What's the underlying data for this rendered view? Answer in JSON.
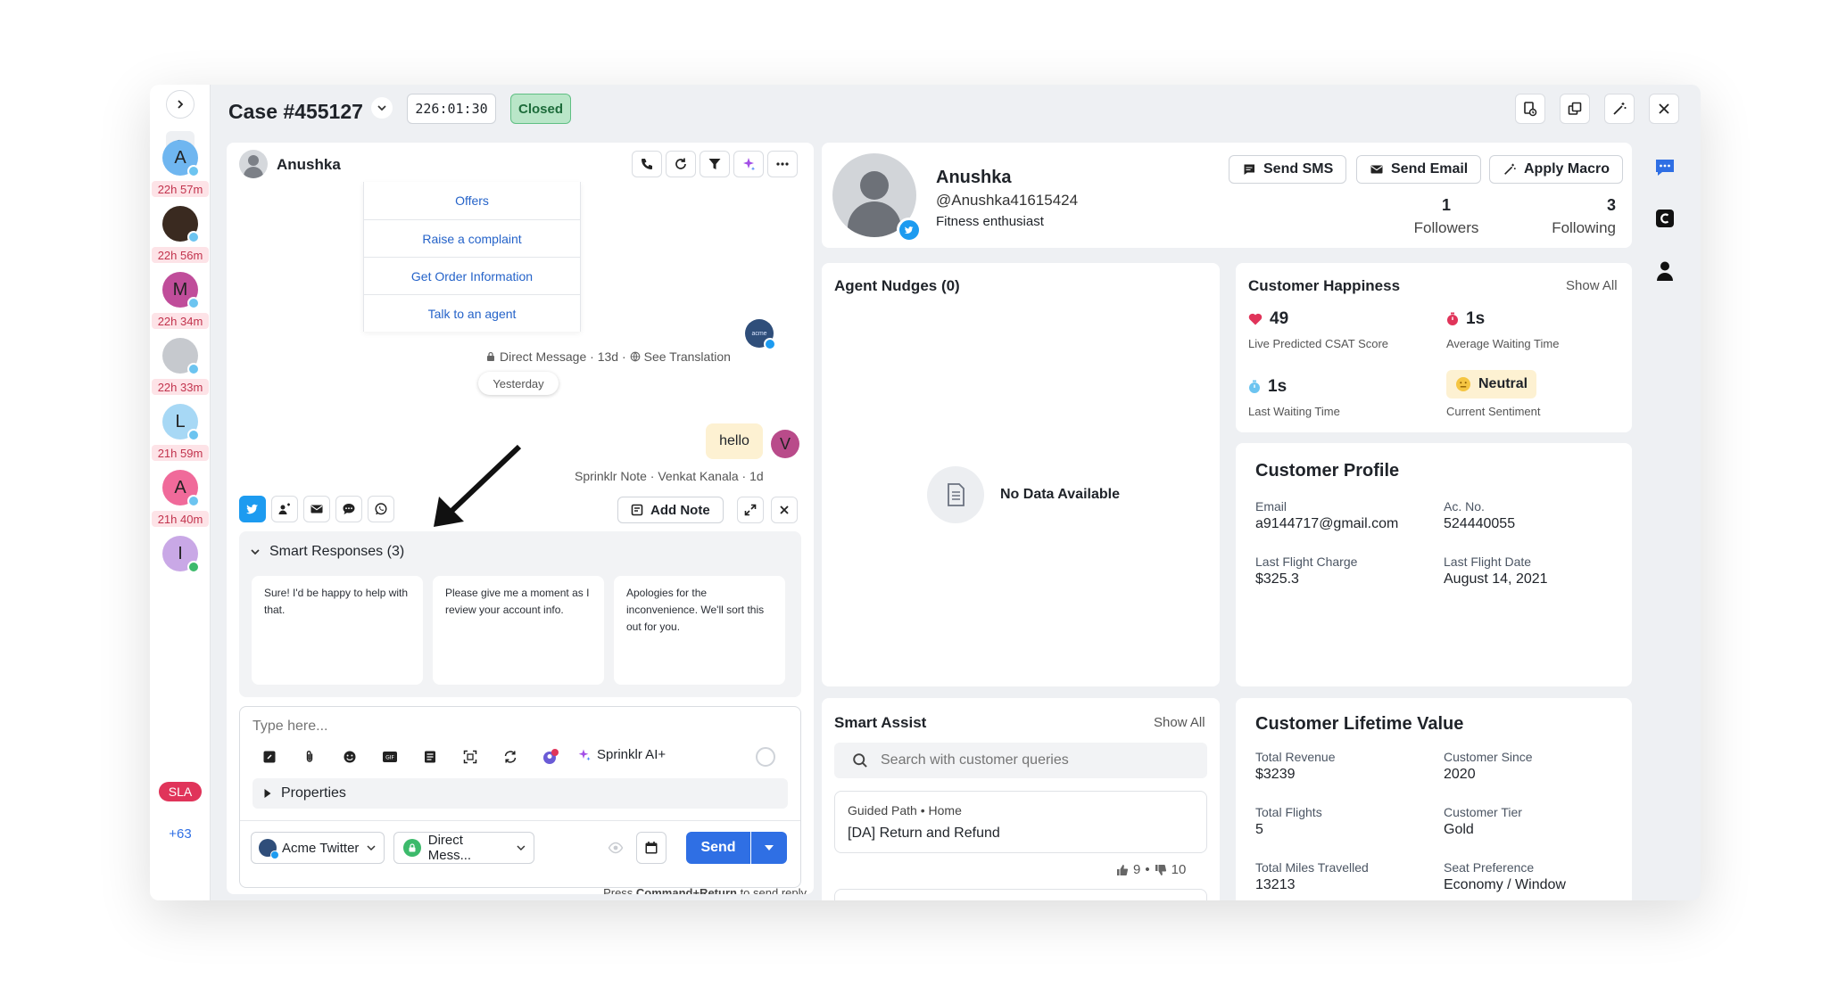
{
  "header": {
    "case_title": "Case #455127",
    "timer": "226:01:30",
    "status": "Closed"
  },
  "rail": {
    "items": [
      {
        "initial": "A",
        "time": "22h 57m",
        "bg": "#6fb6f0"
      },
      {
        "initial": "",
        "time": "22h 56m",
        "bg": "#3a2a20"
      },
      {
        "initial": "M",
        "time": "22h 34m",
        "bg": "#c04d9a"
      },
      {
        "initial": "",
        "time": "22h 33m",
        "bg": "#c6c9ce"
      },
      {
        "initial": "L",
        "time": "21h 59m",
        "bg": "#a7d8f5"
      },
      {
        "initial": "A",
        "time": "21h 40m",
        "bg": "#f06a9a"
      },
      {
        "initial": "I",
        "time": "",
        "bg": "#c9a8e6"
      }
    ],
    "sla": "SLA",
    "more": "+63"
  },
  "conversation": {
    "contact_name": "Anushka",
    "quick_replies": [
      "Offers",
      "Raise a complaint",
      "Get Order Information",
      "Talk to an agent"
    ],
    "bot_avatar_text": "acme",
    "meta": "Direct Message · 13d · ",
    "see_translation": "See Translation",
    "date_divider": "Yesterday",
    "note_text": "hello",
    "note_avatar": "V",
    "note_meta": "Sprinklr Note · Venkat Kanala · 1d",
    "add_note": "Add Note",
    "smart_responses_title": "Smart Responses (3)",
    "smart_responses": [
      "Sure! I'd be happy to help with that.",
      "Please give me a moment as I review your account info.",
      "Apologies for the inconvenience. We'll sort this out for you."
    ],
    "composer_placeholder": "Type here...",
    "sprinklr_ai": "Sprinklr AI+",
    "properties": "Properties",
    "account_select": "Acme Twitter",
    "channel_select": "Direct Mess...",
    "send": "Send",
    "hint_prefix": "Press ",
    "hint_keys": "Command+Return",
    "hint_suffix": " to send reply"
  },
  "profile": {
    "name": "Anushka",
    "handle": "@Anushka41615424",
    "bio": "Fitness enthusiast",
    "send_sms": "Send SMS",
    "send_email": "Send Email",
    "apply_macro": "Apply Macro",
    "followers_count": "1",
    "followers_label": "Followers",
    "following_count": "3",
    "following_label": "Following"
  },
  "agent_nudges": {
    "title": "Agent Nudges (0)",
    "empty": "No Data Available"
  },
  "happiness": {
    "title": "Customer Happiness",
    "show_all": "Show All",
    "csat_value": "49",
    "csat_label": "Live Predicted CSAT Score",
    "avg_wait_value": "1s",
    "avg_wait_label": "Average Waiting Time",
    "last_wait_value": "1s",
    "last_wait_label": "Last Waiting Time",
    "sentiment_value": "Neutral",
    "sentiment_label": "Current Sentiment"
  },
  "customer_profile": {
    "title": "Customer Profile",
    "fields": [
      {
        "label": "Email",
        "value": "a9144717@gmail.com"
      },
      {
        "label": "Ac. No.",
        "value": "524440055"
      },
      {
        "label": "Last Flight Charge",
        "value": "$325.3"
      },
      {
        "label": "Last Flight Date",
        "value": "August 14, 2021"
      }
    ]
  },
  "smart_assist": {
    "title": "Smart Assist",
    "show_all": "Show All",
    "search_placeholder": "Search with customer queries",
    "path_crumb": "Guided Path • Home",
    "path_title": "[DA] Return and Refund",
    "likes": "9",
    "sep": "•",
    "dislikes": "10"
  },
  "clv": {
    "title": "Customer Lifetime Value",
    "fields": [
      {
        "label": "Total Revenue",
        "value": "$3239"
      },
      {
        "label": "Customer Since",
        "value": "2020"
      },
      {
        "label": "Total Flights",
        "value": "5"
      },
      {
        "label": "Customer Tier",
        "value": "Gold"
      },
      {
        "label": "Total Miles Travelled",
        "value": "13213"
      },
      {
        "label": "Seat Preference",
        "value": "Economy / Window"
      }
    ]
  },
  "colors": {
    "accent_blue": "#2f6fe4",
    "closed_bg": "#b9e6c8",
    "closed_text": "#1d6b3a",
    "sla_red": "#e0345a",
    "twitter": "#1d9bf0"
  }
}
